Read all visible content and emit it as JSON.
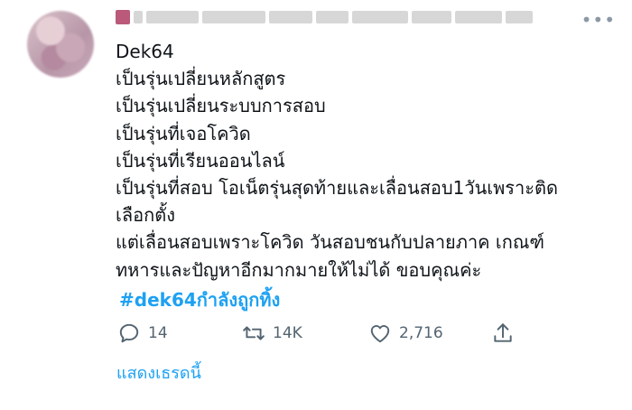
{
  "tweet": {
    "text_lines": [
      "Dek64",
      "เป็นรุ่นเปลี่ยนหลักสูตร",
      "เป็นรุ่นเปลี่ยนระบบการสอบ",
      "เป็นรุ่นที่เจอโควิด",
      "เป็นรุ่นที่เรียนออนไลน์",
      "เป็นรุ่นที่สอบ โอเน็ตรุ่นสุดท้ายและเลื่อนสอบ1วันเพราะติด",
      "เลือกตั้ง",
      "แต่เลื่อนสอบเพราะโควิด วันสอบชนกับปลายภาค เกณฑ์",
      "ทหารและปัญหาอีกมากมายให้ไม่ได้ ขอบคุณค่ะ"
    ],
    "hashtag": "#dek64กำลังถูกทิ้ง",
    "reply_count": "14",
    "retweet_count": "14K",
    "like_count": "2,716",
    "show_thread": "แสดงเธรดนี้"
  },
  "icons": {
    "reply": "reply-icon",
    "retweet": "retweet-icon",
    "like": "heart-icon",
    "share": "share-icon",
    "more": "more-icon"
  },
  "colors": {
    "link": "#1da1f2",
    "muted": "#536471",
    "text": "#0f1419"
  }
}
